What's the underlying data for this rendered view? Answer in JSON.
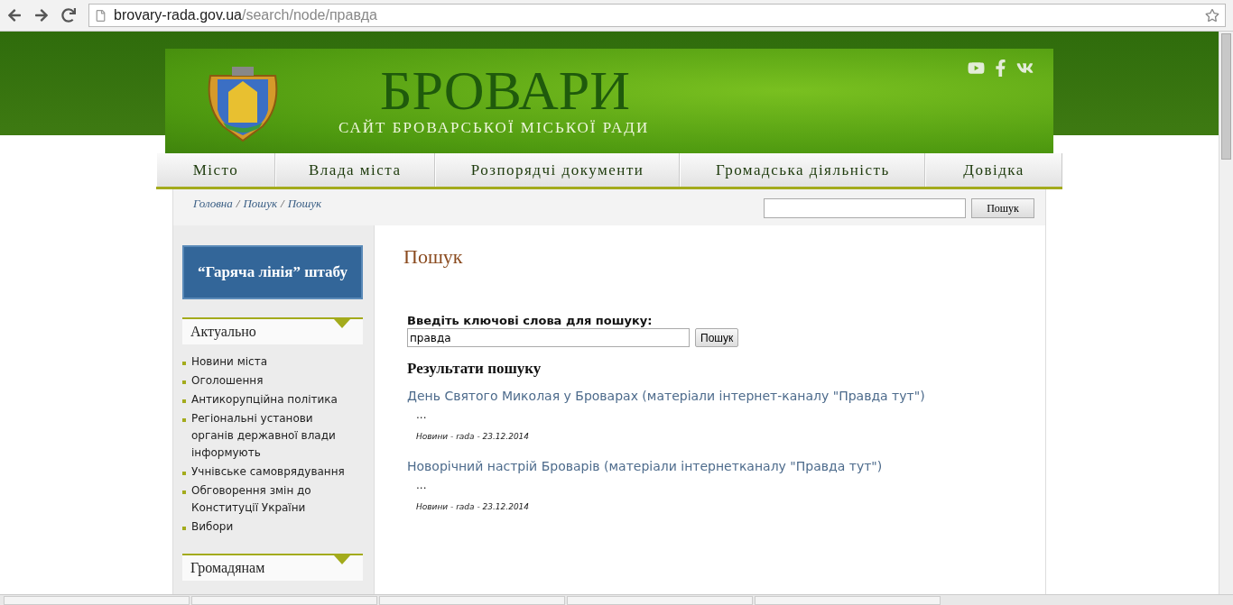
{
  "browser": {
    "url_host": "brovary-rada.gov.ua",
    "url_path": "/search/node/правда"
  },
  "header": {
    "title": "БРОВАРИ",
    "subtitle": "САЙТ БРОВАРСЬКОЇ МІСЬКОЇ РАДИ"
  },
  "nav": [
    {
      "label": "Місто"
    },
    {
      "label": "Влада міста"
    },
    {
      "label": "Розпорядчі документи"
    },
    {
      "label": "Громадська діяльність"
    },
    {
      "label": "Довідка"
    }
  ],
  "breadcrumbs": [
    "Головна",
    "Пошук",
    "Пошук"
  ],
  "breadcrumb_separator": "/",
  "top_search": {
    "button": "Пошук"
  },
  "hotline": "“Гаряча лінія” штабу",
  "sidebar": [
    {
      "title": "Актуально",
      "items": [
        "Новини міста",
        "Оголошення",
        "Антикорупційна політика",
        "Регіональні установи органів державної влади інформують",
        "Учнівське самоврядування",
        "Обговорення змін до Конституції України",
        "Вибори"
      ]
    },
    {
      "title": "Громадянам"
    }
  ],
  "page_title": "Пошук",
  "search_form": {
    "label": "Введіть ключові слова для пошуку:",
    "value": "правда",
    "button": "Пошук"
  },
  "results_title": "Результати пошуку",
  "results": [
    {
      "title": "День Святого Миколая у Броварах (матеріали інтернет-каналу \"Правда тут\")",
      "snippet": "...",
      "meta": "Новини - rada - 23.12.2014"
    },
    {
      "title": "Новорічний настрій Броварів (матеріали інтернетканалу \"Правда тут\")",
      "snippet": "...",
      "meta": "Новини - rada - 23.12.2014"
    }
  ]
}
